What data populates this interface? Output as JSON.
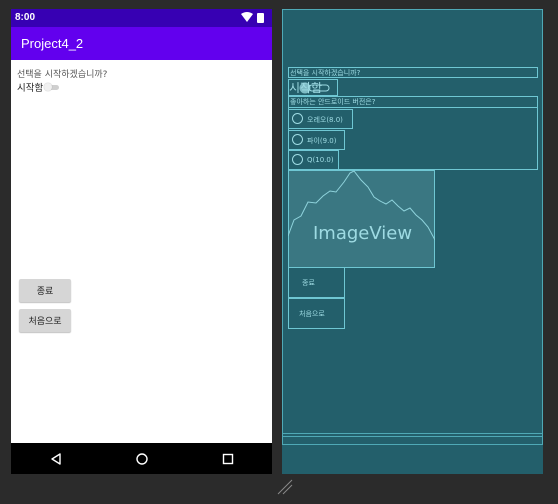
{
  "status_bar": {
    "time": "8:00"
  },
  "app_bar": {
    "title": "Project4_2"
  },
  "main": {
    "question": "선택을 시작하겠습니까?",
    "switch_label": "시작함",
    "buttons": {
      "exit": "종료",
      "restart": "처음으로"
    }
  },
  "blueprint": {
    "question": "선택을 시작하겠습니까?",
    "switch_label": "시작함",
    "radio_header": "좋아하는 안드로이드 버전은?",
    "radios": [
      "오레오(8.0)",
      "파이(9.0)",
      "Q(10.0)"
    ],
    "image_label": "ImageView",
    "buttons": {
      "exit": "종료",
      "restart": "처음으로"
    }
  },
  "colors": {
    "status_bar": "#3700b3",
    "app_bar": "#6200ee",
    "blueprint_bg": "#235f6b",
    "blueprint_line": "#6fc7d3",
    "button": "#d6d6d6"
  }
}
